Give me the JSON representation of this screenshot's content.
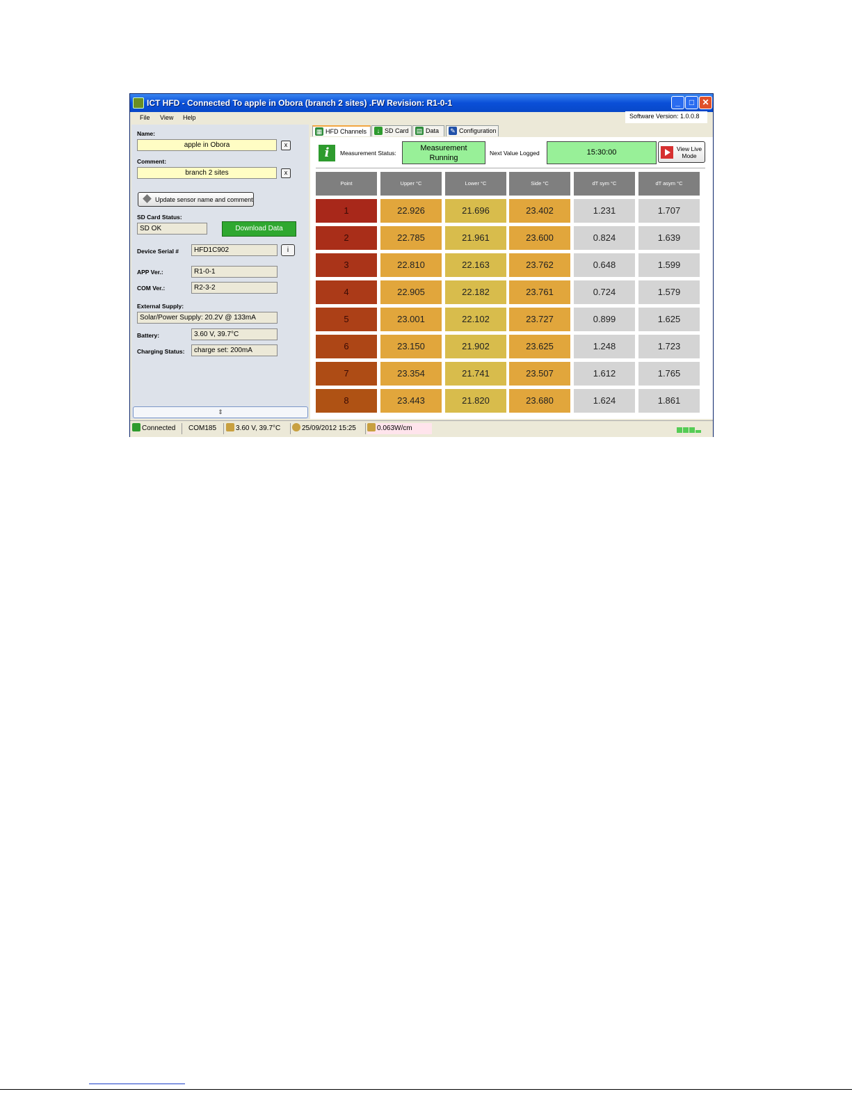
{
  "window": {
    "title": "ICT HFD - Connected To apple in Obora (branch 2 sites) .FW Revision: R1-0-1",
    "software_version": "Software Version: 1.0.0.8"
  },
  "menu": {
    "file": "File",
    "view": "View",
    "help": "Help"
  },
  "left_panel": {
    "name_label": "Name:",
    "name_value": "apple in Obora",
    "comment_label": "Comment:",
    "comment_value": "branch 2 sites",
    "clear_btn": "x",
    "update_btn": "Update sensor name and comment",
    "sd_status_label": "SD Card Status:",
    "sd_status_value": "SD OK",
    "download_btn": "Download Data",
    "serial_label": "Device Serial #",
    "serial_value": "HFD1C902",
    "info_btn": "i",
    "app_label": "APP Ver.:",
    "app_value": "R1-0-1",
    "com_label": "COM Ver.:",
    "com_value": "R2-3-2",
    "ext_label": "External Supply:",
    "ext_value": "Solar/Power Supply: 20.2V @ 133mA",
    "battery_label": "Battery:",
    "battery_value": "3.60 V, 39.7°C",
    "charging_label": "Charging Status:",
    "charging_value": "charge set: 200mA"
  },
  "tabs": [
    "HFD Channels",
    "SD Card",
    "Data",
    "Configuration"
  ],
  "status_area": {
    "measurement_label": "Measurement Status:",
    "measurement_line1": "Measurement",
    "measurement_line2": "Running",
    "next_label": "Next Value Logged",
    "next_value": "15:30:00",
    "live_line1": "View Live",
    "live_line2": "Mode"
  },
  "table": {
    "headers": [
      "Point",
      "Upper °C",
      "Lower °C",
      "Side °C",
      "dT sym °C",
      "dT asym °C"
    ],
    "rows": [
      [
        "1",
        "22.926",
        "21.696",
        "23.402",
        "1.231",
        "1.707"
      ],
      [
        "2",
        "22.785",
        "21.961",
        "23.600",
        "0.824",
        "1.639"
      ],
      [
        "3",
        "22.810",
        "22.163",
        "23.762",
        "0.648",
        "1.599"
      ],
      [
        "4",
        "22.905",
        "22.182",
        "23.761",
        "0.724",
        "1.579"
      ],
      [
        "5",
        "23.001",
        "22.102",
        "23.727",
        "0.899",
        "1.625"
      ],
      [
        "6",
        "23.150",
        "21.902",
        "23.625",
        "1.248",
        "1.723"
      ],
      [
        "7",
        "23.354",
        "21.741",
        "23.507",
        "1.612",
        "1.765"
      ],
      [
        "8",
        "23.443",
        "21.820",
        "23.680",
        "1.624",
        "1.861"
      ]
    ],
    "point_colors": [
      "#a8281a",
      "#a92e19",
      "#aa3419",
      "#ab3a18",
      "#ac4017",
      "#ad4616",
      "#ae4c15",
      "#af5214"
    ],
    "upper_color": "#e1a63c",
    "lower_color": "#d8bc4c",
    "side_color": "#e1a63c",
    "dt_color": "#d4d4d4"
  },
  "statusbar": {
    "connected": "Connected",
    "port": "COM185",
    "battery": "3.60 V, 39.7°C",
    "datetime": "25/09/2012 15:25",
    "flux": "0.063W/cm"
  }
}
